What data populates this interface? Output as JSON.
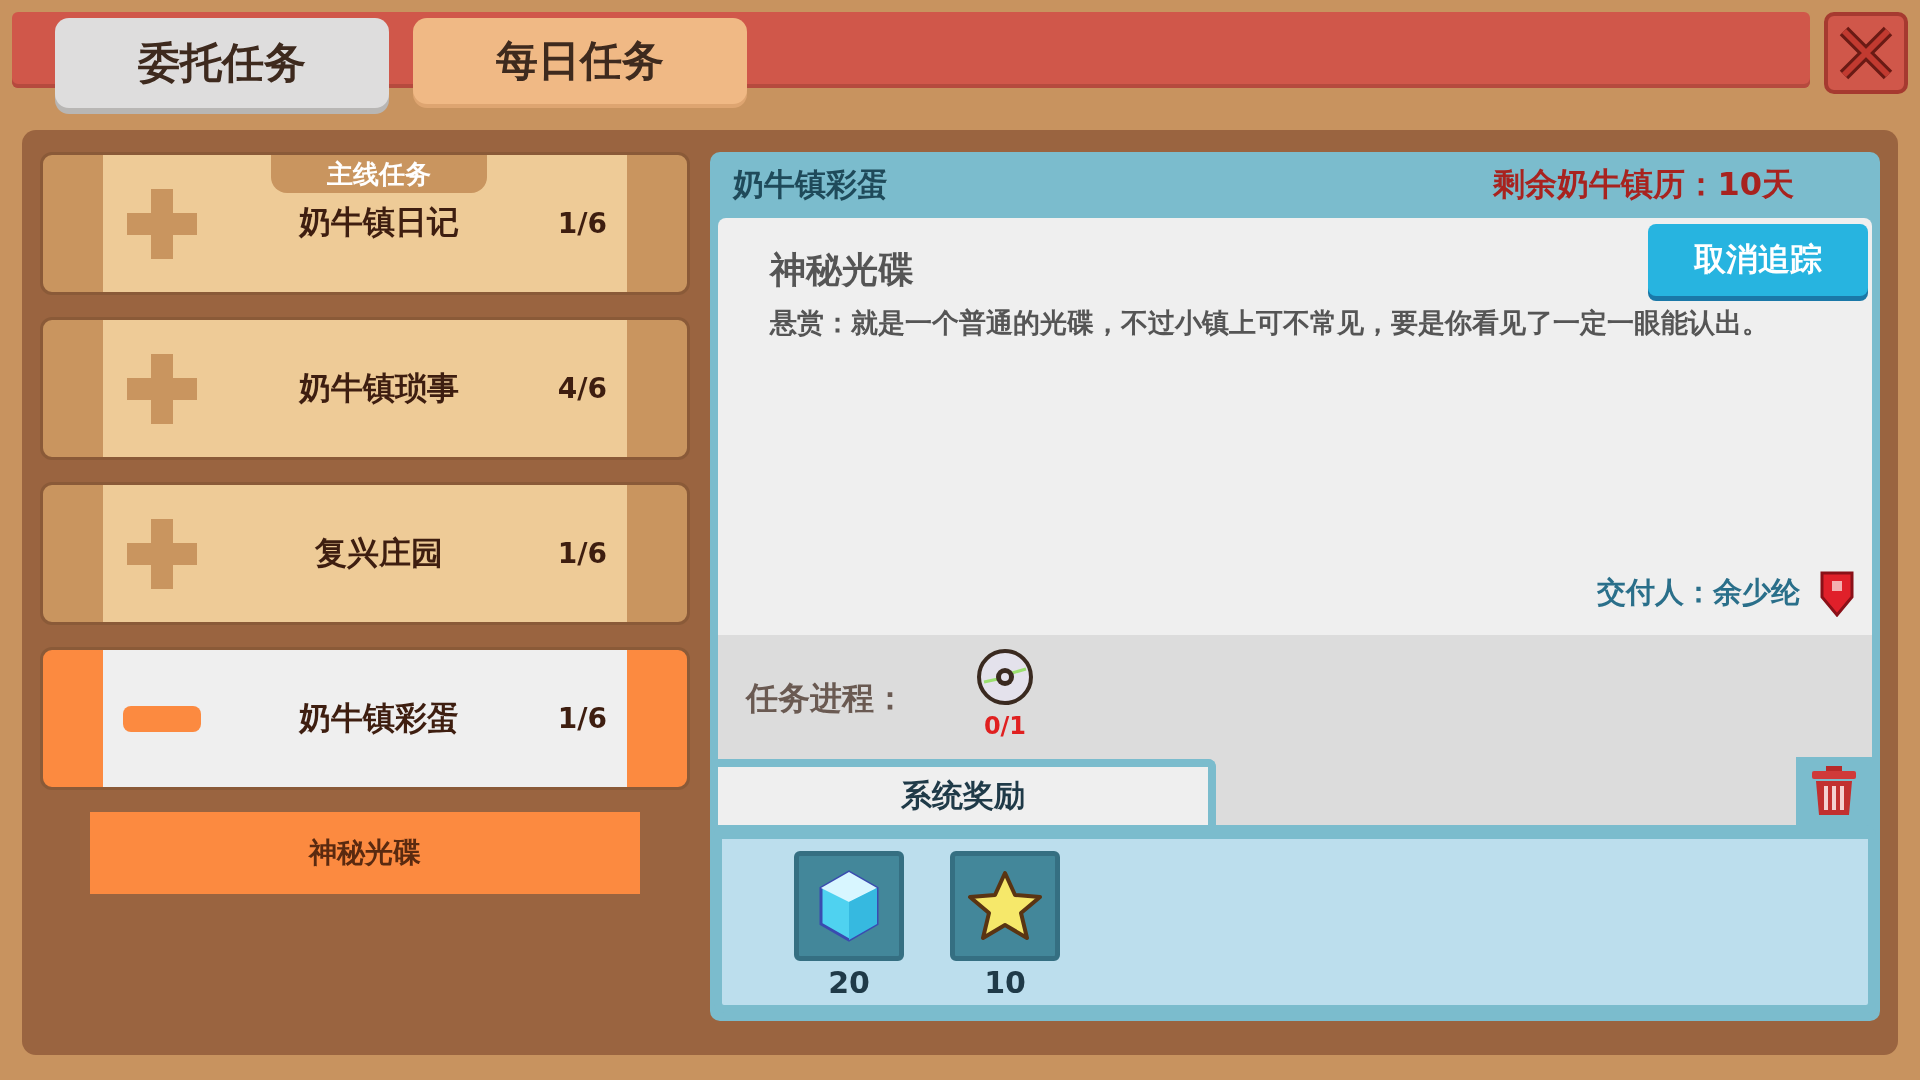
{
  "tabs": [
    {
      "label": "委托任务",
      "selected": true
    },
    {
      "label": "每日任务",
      "selected": false
    }
  ],
  "quests": [
    {
      "category": "主线任务",
      "label": "奶牛镇日记",
      "progress": "1/6",
      "expanded": false,
      "selected": false
    },
    {
      "label": "奶牛镇琐事",
      "progress": "4/6",
      "expanded": false,
      "selected": false
    },
    {
      "label": "复兴庄园",
      "progress": "1/6",
      "expanded": false,
      "selected": false
    },
    {
      "label": "奶牛镇彩蛋",
      "progress": "1/6",
      "expanded": true,
      "selected": true,
      "children": [
        {
          "label": "神秘光碟"
        }
      ]
    }
  ],
  "detail": {
    "header_title": "奶牛镇彩蛋",
    "remaining": "剩余奶牛镇历：10天",
    "title": "神秘光碟",
    "untrack_button": "取消追踪",
    "description": "悬赏：就是一个普通的光碟，不过小镇上可不常见，要是你看见了一定一眼能认出。",
    "giver": "交付人：余少纶",
    "progress_label": "任务进程：",
    "progress_items": [
      {
        "kind": "disc",
        "count": "0/1"
      }
    ],
    "rewards_tab": "系统奖励",
    "rewards": [
      {
        "kind": "gem",
        "amount": "20"
      },
      {
        "kind": "star",
        "amount": "10"
      }
    ]
  }
}
